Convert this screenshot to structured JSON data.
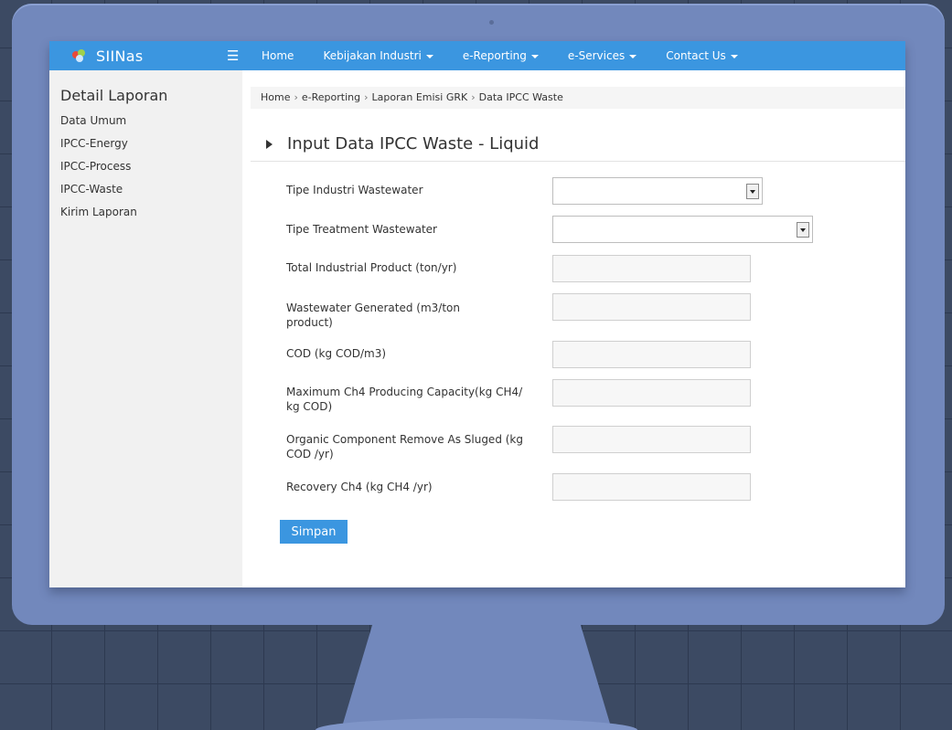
{
  "navbar": {
    "brand": "SIINas",
    "menu_icon": "hamburger-icon",
    "items": [
      {
        "label": "Home",
        "dropdown": false
      },
      {
        "label": "Kebijakan Industri",
        "dropdown": true
      },
      {
        "label": "e-Reporting",
        "dropdown": true
      },
      {
        "label": "e-Services",
        "dropdown": true
      },
      {
        "label": "Contact Us",
        "dropdown": true
      }
    ]
  },
  "sidebar": {
    "title": "Detail Laporan",
    "items": [
      {
        "label": "Data Umum"
      },
      {
        "label": "IPCC-Energy"
      },
      {
        "label": "IPCC-Process"
      },
      {
        "label": "IPCC-Waste"
      },
      {
        "label": "Kirim Laporan"
      }
    ]
  },
  "breadcrumb": {
    "separator": "›",
    "items": [
      "Home",
      "e-Reporting",
      "Laporan Emisi GRK",
      "Data IPCC Waste"
    ]
  },
  "page": {
    "title": "Input Data IPCC Waste - Liquid"
  },
  "form": {
    "fields": [
      {
        "label": "Tipe Industri Wastewater",
        "type": "select",
        "value": ""
      },
      {
        "label": "Tipe Treatment Wastewater",
        "type": "select",
        "value": ""
      },
      {
        "label": "Total Industrial Product (ton/yr)",
        "type": "text",
        "value": ""
      },
      {
        "label": "Wastewater Generated (m3/ton product)",
        "type": "text",
        "value": ""
      },
      {
        "label": "COD (kg COD/m3)",
        "type": "text",
        "value": ""
      },
      {
        "label": "Maximum Ch4 Producing Capacity(kg CH4/ kg COD)",
        "type": "text",
        "value": ""
      },
      {
        "label": "Organic Component Remove As Sluged (kg COD /yr)",
        "type": "text",
        "value": ""
      },
      {
        "label": "Recovery Ch4 (kg CH4 /yr)",
        "type": "text",
        "value": ""
      }
    ],
    "submit_label": "Simpan"
  },
  "colors": {
    "navbar_blue": "#3b96e0",
    "monitor_frame": "#7288bc",
    "background": "#3c4a63",
    "sidebar_bg": "#f1f1f1"
  }
}
